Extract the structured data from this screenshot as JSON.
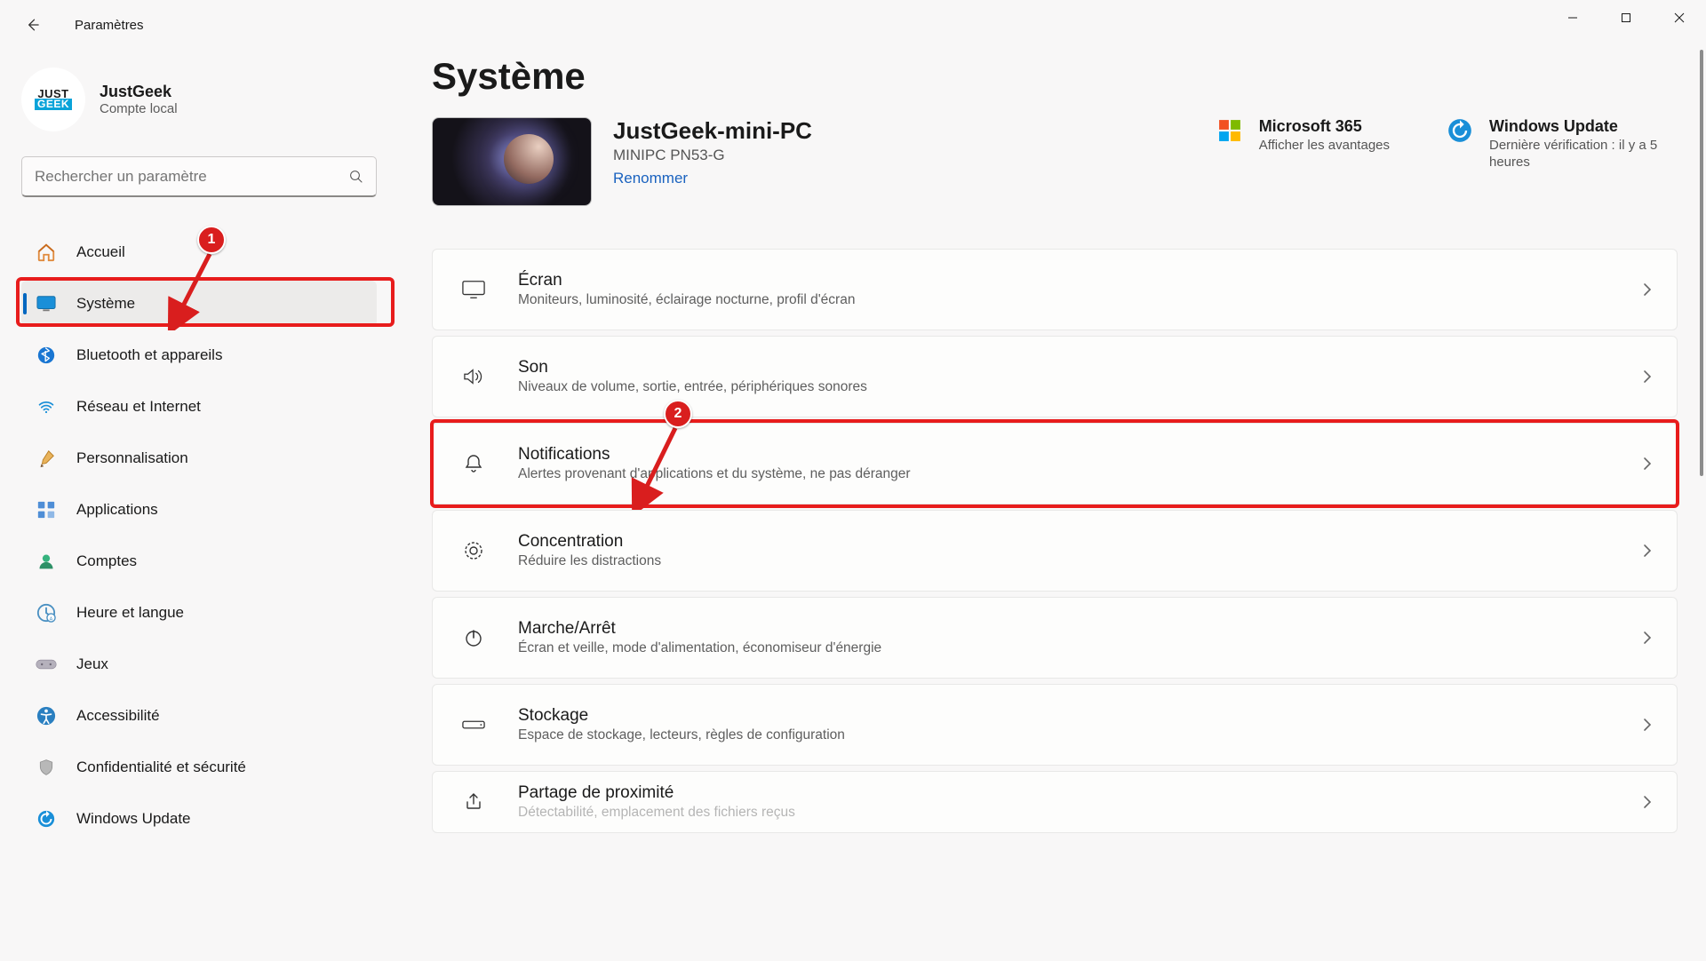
{
  "window": {
    "title": "Paramètres"
  },
  "account": {
    "name": "JustGeek",
    "type": "Compte local",
    "avatar_top": "JUST",
    "avatar_bottom": "GEEK"
  },
  "search": {
    "placeholder": "Rechercher un paramètre"
  },
  "sidebar": {
    "items": [
      {
        "label": "Accueil",
        "icon": "home-icon"
      },
      {
        "label": "Système",
        "icon": "system-icon",
        "selected": true
      },
      {
        "label": "Bluetooth et appareils",
        "icon": "bluetooth-icon"
      },
      {
        "label": "Réseau et Internet",
        "icon": "wifi-icon"
      },
      {
        "label": "Personnalisation",
        "icon": "brush-icon"
      },
      {
        "label": "Applications",
        "icon": "apps-icon"
      },
      {
        "label": "Comptes",
        "icon": "user-icon"
      },
      {
        "label": "Heure et langue",
        "icon": "time-lang-icon"
      },
      {
        "label": "Jeux",
        "icon": "games-icon"
      },
      {
        "label": "Accessibilité",
        "icon": "accessibility-icon"
      },
      {
        "label": "Confidentialité et sécurité",
        "icon": "privacy-icon"
      },
      {
        "label": "Windows Update",
        "icon": "update-icon"
      }
    ]
  },
  "main": {
    "title": "Système",
    "sysinfo": {
      "pc_name": "JustGeek-mini-PC",
      "model": "MINIPC PN53-G",
      "rename": "Renommer"
    },
    "m365": {
      "title": "Microsoft 365",
      "sub": "Afficher les avantages"
    },
    "update": {
      "title": "Windows Update",
      "sub": "Dernière vérification : il y a 5 heures"
    },
    "rows": [
      {
        "icon": "display-icon",
        "title": "Écran",
        "sub": "Moniteurs, luminosité, éclairage nocturne, profil d'écran"
      },
      {
        "icon": "sound-icon",
        "title": "Son",
        "sub": "Niveaux de volume, sortie, entrée, périphériques sonores"
      },
      {
        "icon": "bell-icon",
        "title": "Notifications",
        "sub": "Alertes provenant d'applications et du système, ne pas déranger"
      },
      {
        "icon": "focus-icon",
        "title": "Concentration",
        "sub": "Réduire les distractions"
      },
      {
        "icon": "power-icon",
        "title": "Marche/Arrêt",
        "sub": "Écran et veille, mode d'alimentation, économiseur d'énergie"
      },
      {
        "icon": "storage-icon",
        "title": "Stockage",
        "sub": "Espace de stockage, lecteurs, règles de configuration"
      },
      {
        "icon": "share-icon",
        "title": "Partage de proximité",
        "sub": "Détectabilité, emplacement des fichiers reçus"
      }
    ]
  },
  "annotations": {
    "badge1": "1",
    "badge2": "2"
  }
}
